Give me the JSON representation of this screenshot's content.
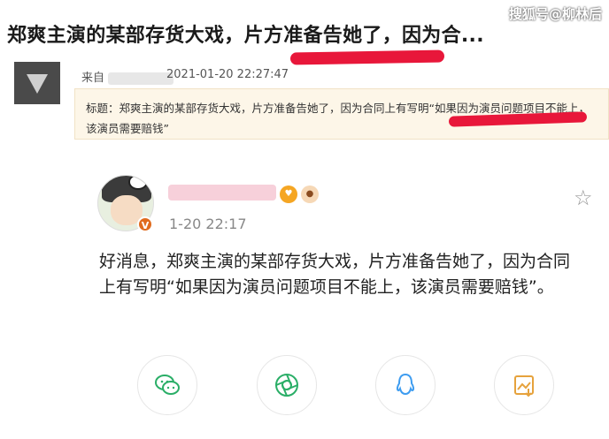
{
  "headline": "郑爽主演的某部存货大戏，片方准备告她了，因为合...",
  "watermark": "搜狐号@柳林后",
  "quote": {
    "source_prefix": "来自",
    "time": "2021-01-20 22:27:47",
    "text": "标题：郑爽主演的某部存货大戏，片方准备告她了，因为合同上有写明“如果因为演员问题项目不能上，该演员需要赔钱”"
  },
  "post": {
    "time": "1-20 22:17",
    "body": "好消息，郑爽主演的某部存货大戏，片方准备告她了，因为合同上有写明“如果因为演员问题项目不能上，该演员需要赔钱”。",
    "vip_badge": "V",
    "icons": [
      "fan-badge-icon",
      "pet-badge-icon",
      "star-icon"
    ]
  },
  "actions": [
    "wechat-icon",
    "moments-icon",
    "qq-icon",
    "save-image-icon"
  ],
  "colors": {
    "highlight": "#e8173a",
    "quote_bg": "#fdf6e8",
    "vip": "#e06b1e"
  }
}
